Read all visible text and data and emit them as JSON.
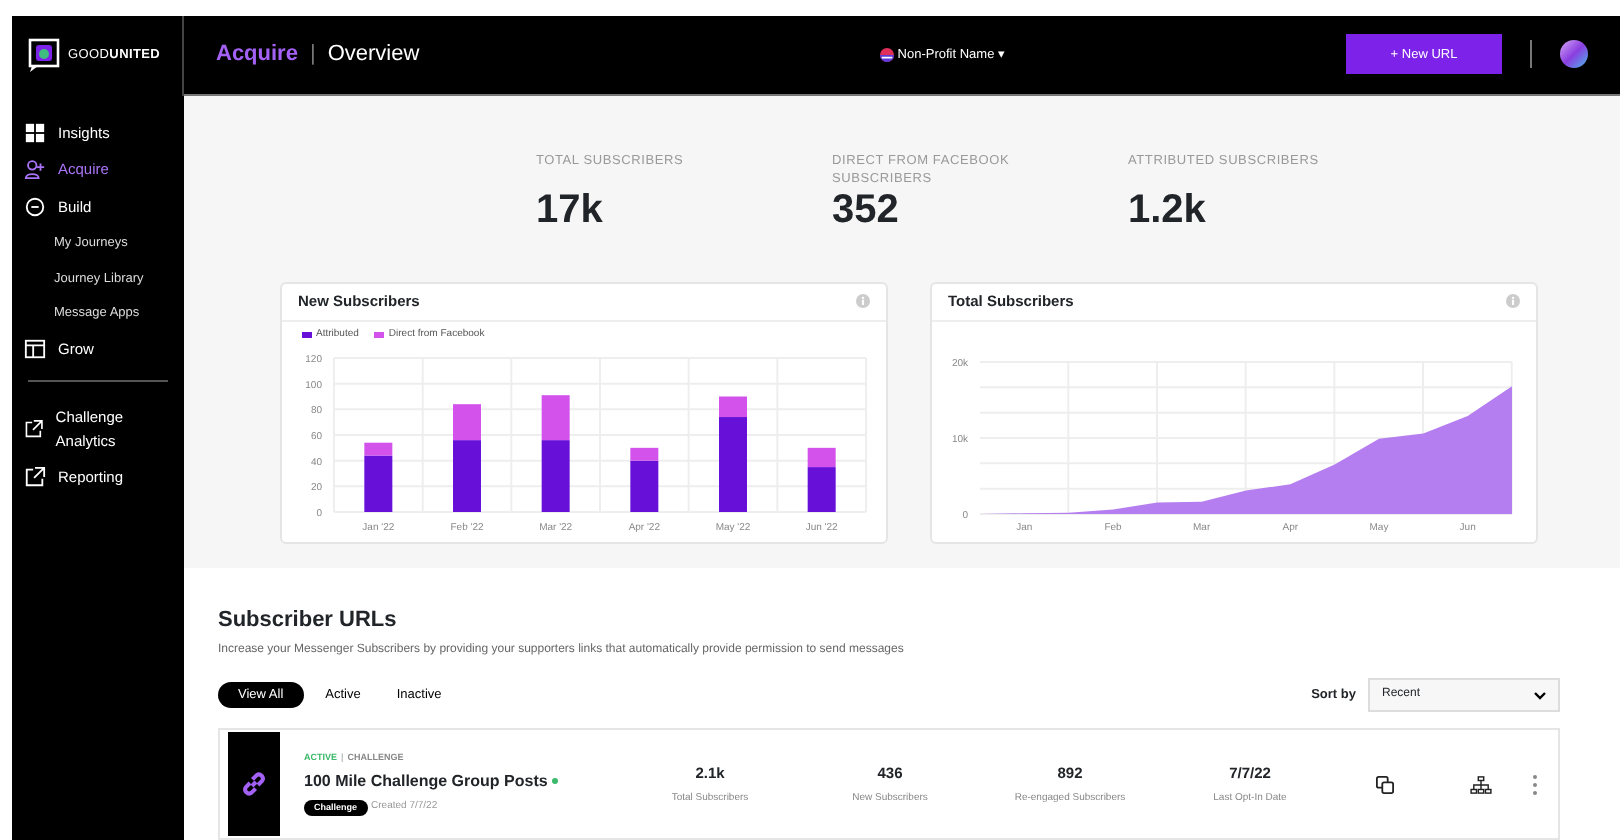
{
  "brand": {
    "name_light": "GOOD",
    "name_bold": "UNITED"
  },
  "sidebar": {
    "items": [
      {
        "label": "Insights",
        "selected": false
      },
      {
        "label": "Acquire",
        "selected": true
      },
      {
        "label": "Build",
        "selected": false,
        "children": [
          {
            "label": "My Journeys",
            "selected": false
          },
          {
            "label": "Journey Library",
            "selected": false
          },
          {
            "label": "Message Apps",
            "selected": false
          }
        ]
      },
      {
        "label": "Grow",
        "selected": false
      },
      {
        "label": "Challenge Analytics",
        "selected": false,
        "divider_before": true
      },
      {
        "label": "Reporting",
        "selected": false
      }
    ]
  },
  "header": {
    "section": "Acquire",
    "separator": "|",
    "page": "Overview",
    "org": "Non-Profit Name",
    "org_caret": "▾",
    "new_button": "+ New URL"
  },
  "stats": [
    {
      "label": "TOTAL SUBSCRIBERS",
      "value": "17k"
    },
    {
      "label": "DIRECT FROM FACEBOOK SUBSCRIBERS",
      "value": "352"
    },
    {
      "label": "ATTRIBUTED SUBSCRIBERS",
      "value": "1.2k"
    }
  ],
  "new_subscribers": {
    "title": "New Subscribers",
    "chart_data": {
      "type": "bar",
      "stacked": true,
      "grid": true,
      "categories": [
        "Jan '22",
        "Feb '22",
        "Mar '22",
        "Apr '22",
        "May '22",
        "Jun '22"
      ],
      "ylim": [
        0,
        120
      ],
      "yticks": [
        0,
        20,
        40,
        60,
        80,
        100,
        120
      ],
      "series": [
        {
          "name": "Attributed",
          "color": "#6610d8",
          "values": [
            44,
            56,
            56,
            40,
            74,
            35
          ]
        },
        {
          "name": "Direct from Facebook",
          "color": "#d352ec",
          "values": [
            10,
            28,
            35,
            10,
            16,
            15
          ]
        }
      ]
    }
  },
  "total_subscribers": {
    "title": "Total Subscribers",
    "chart_data": {
      "type": "area",
      "grid": true,
      "categories": [
        null,
        "Jan",
        null,
        "Feb",
        null,
        "Mar",
        null,
        "Apr",
        null,
        "May",
        null,
        "Jun",
        null
      ],
      "ylim": [
        0,
        20000
      ],
      "yticks": [
        {
          "value": 0,
          "label": "0"
        },
        {
          "value": 10000,
          "label": "10k"
        },
        {
          "value": 20000,
          "label": "20k"
        }
      ],
      "series": [
        {
          "color": "#b57ef0",
          "values": [
            0,
            100,
            150,
            600,
            1500,
            1600,
            3100,
            3900,
            6500,
            9900,
            10600,
            12900,
            16800
          ]
        }
      ]
    }
  },
  "subscriber_urls": {
    "title": "Subscriber URLs",
    "description": "Increase your Messenger Subscribers by providing your supporters links that automatically provide permission to send messages",
    "filters": [
      {
        "label": "View All",
        "selected": true
      },
      {
        "label": "Active",
        "selected": false
      },
      {
        "label": "Inactive",
        "selected": false
      }
    ],
    "sort_label": "Sort by",
    "sort_value": "Recent",
    "rows": [
      {
        "status": "ACTIVE",
        "separator": "|",
        "type": "CHALLENGE",
        "title": "100 Mile Challenge Group Posts",
        "online": true,
        "tag": "Challenge",
        "created": "Created 7/7/22",
        "metrics": [
          {
            "value": "2.1k",
            "label": "Total Subscribers"
          },
          {
            "value": "436",
            "label": "New Subscribers"
          },
          {
            "value": "892",
            "label": "Re-engaged Subscribers"
          },
          {
            "value": "7/7/22",
            "label": "Last Opt-In Date"
          }
        ]
      }
    ]
  }
}
